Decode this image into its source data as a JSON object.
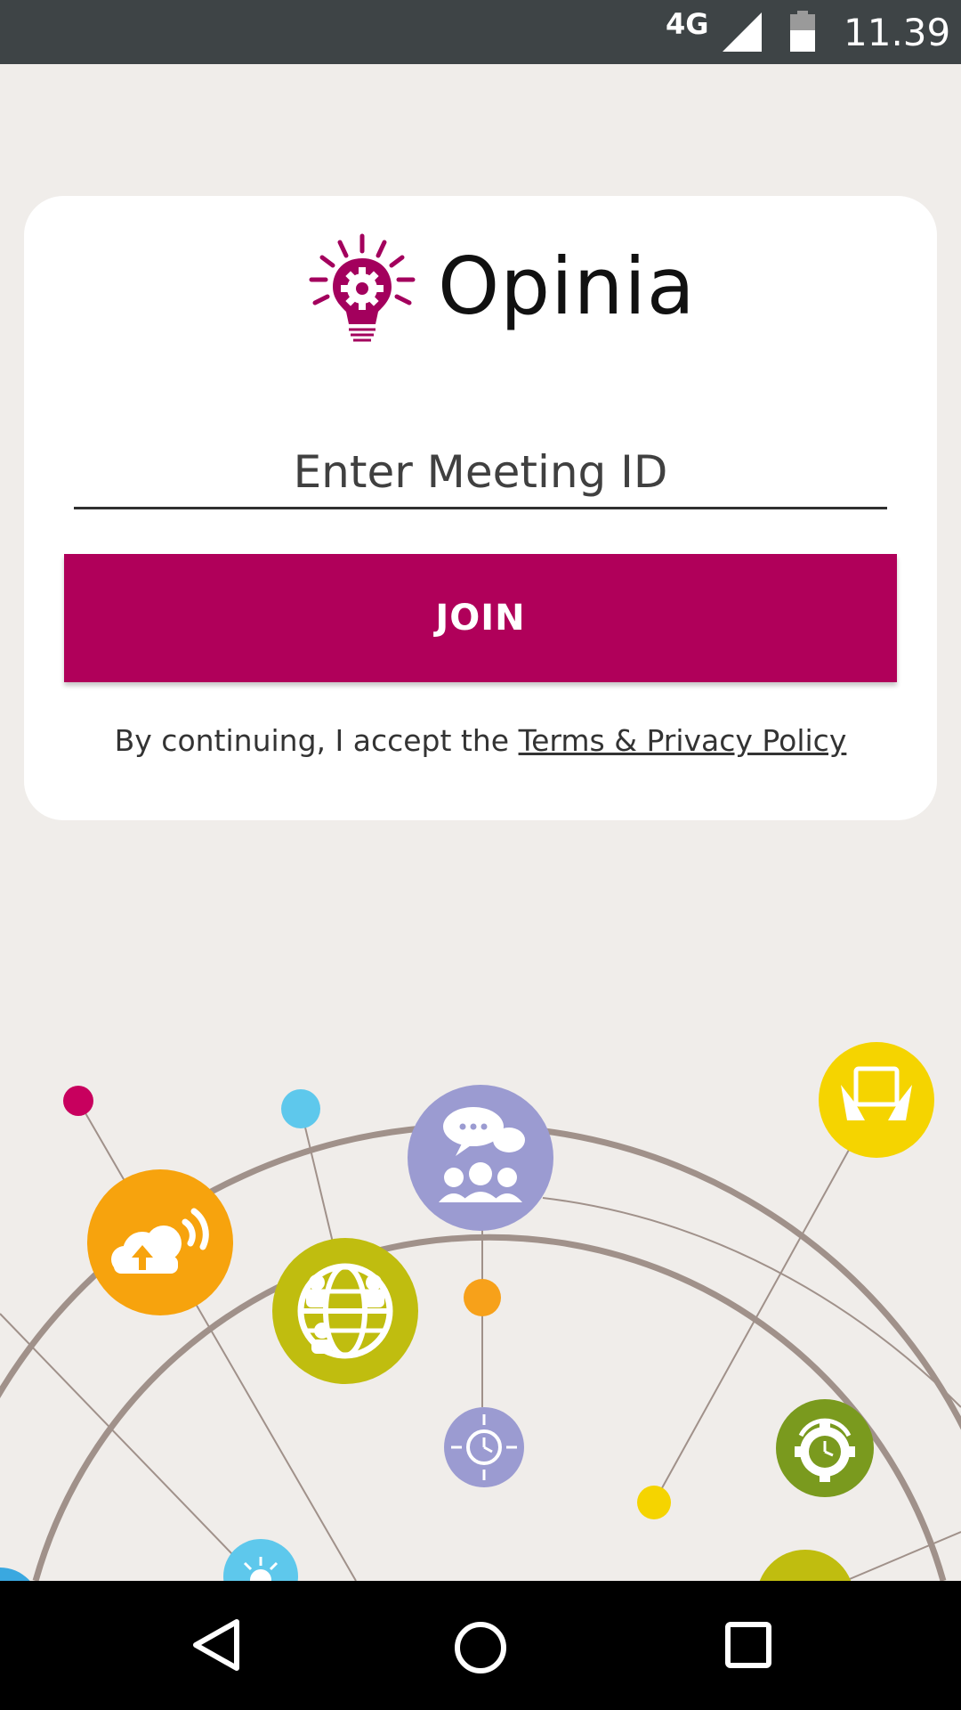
{
  "status_bar": {
    "network": "4G",
    "time": "11.39",
    "signal_icon": "cell-signal-icon",
    "battery_icon": "battery-icon"
  },
  "logo": {
    "name": "Opinia",
    "icon": "lightbulb-gear-icon",
    "color": "#a3005d"
  },
  "form": {
    "meeting_id_placeholder": "Enter Meeting ID",
    "meeting_id_value": "",
    "join_label": "JOIN"
  },
  "terms": {
    "prefix": "By continuing, I accept the ",
    "link": "Terms & Privacy Policy"
  },
  "nav": {
    "back_icon": "back-triangle-icon",
    "home_icon": "home-circle-icon",
    "recents_icon": "recents-square-icon"
  },
  "colors": {
    "accent": "#b0005a",
    "background": "#f0edea",
    "status_bar": "#3e4446"
  }
}
